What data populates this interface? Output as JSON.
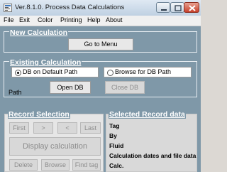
{
  "window": {
    "title": "Ver.8.1.0.  Process Data Calculations"
  },
  "menu": [
    {
      "label": "File"
    },
    {
      "label": "Exit"
    },
    {
      "label": "Color"
    },
    {
      "label": "Printing"
    },
    {
      "label": "Help"
    },
    {
      "label": "About"
    }
  ],
  "new_calculation": {
    "title": "New Calculation",
    "go_to_menu": "Go to Menu"
  },
  "existing_calculation": {
    "title": "Existing Calculation",
    "radio_default": {
      "label": "DB on Default Path",
      "selected": true
    },
    "radio_browse": {
      "label": "Browse for DB Path",
      "selected": false
    },
    "path_label": "Path",
    "open_db": "Open DB",
    "close_db": "Close DB"
  },
  "record_selection": {
    "title": "Record Selection",
    "first": "First",
    "next": ">",
    "prev": "<",
    "last": "Last",
    "display_calculation": "Display calculation",
    "delete": "Delete",
    "browse": "Browse",
    "find_tag": "Find tag"
  },
  "selected_record": {
    "title": "Selected Record data",
    "tag": "Tag",
    "by": "By",
    "fluid": "Fluid",
    "calc_dates": "Calculation dates and file data",
    "calc": "Calc."
  },
  "colors": {
    "background": "#7f98a8",
    "close_button": "#c7402b"
  }
}
